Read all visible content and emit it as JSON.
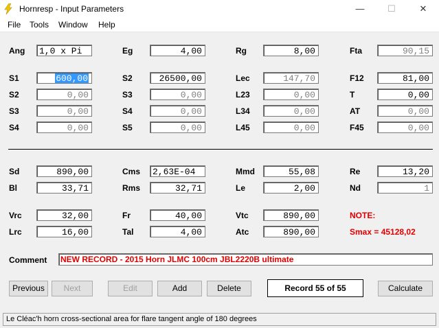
{
  "window": {
    "title": "Hornresp - Input Parameters",
    "minimize_glyph": "—",
    "maximize_glyph": "☐",
    "close_glyph": "✕"
  },
  "menu": [
    "File",
    "Tools",
    "Window",
    "Help"
  ],
  "params": {
    "Ang": {
      "label": "Ang",
      "value": "1,0 x Pi"
    },
    "Eg": {
      "label": "Eg",
      "value": "4,00"
    },
    "Rg": {
      "label": "Rg",
      "value": "8,00"
    },
    "Fta": {
      "label": "Fta",
      "value": "90,15"
    },
    "S1": {
      "label": "S1",
      "value": "600,00"
    },
    "S2a": {
      "label": "S2",
      "value": "26500,00"
    },
    "Lec": {
      "label": "Lec",
      "value": "147,70"
    },
    "F12": {
      "label": "F12",
      "value": "81,00"
    },
    "S2b": {
      "label": "S2",
      "value": "0,00"
    },
    "S3a": {
      "label": "S3",
      "value": "0,00"
    },
    "L23": {
      "label": "L23",
      "value": "0,00"
    },
    "T": {
      "label": "T",
      "value": "0,00"
    },
    "S3b": {
      "label": "S3",
      "value": "0,00"
    },
    "S4a": {
      "label": "S4",
      "value": "0,00"
    },
    "L34": {
      "label": "L34",
      "value": "0,00"
    },
    "AT": {
      "label": "AT",
      "value": "0,00"
    },
    "S4b": {
      "label": "S4",
      "value": "0,00"
    },
    "S5": {
      "label": "S5",
      "value": "0,00"
    },
    "L45": {
      "label": "L45",
      "value": "0,00"
    },
    "F45": {
      "label": "F45",
      "value": "0,00"
    },
    "Sd": {
      "label": "Sd",
      "value": "890,00"
    },
    "Cms": {
      "label": "Cms",
      "value": "2,63E-04"
    },
    "Mmd": {
      "label": "Mmd",
      "value": "55,08"
    },
    "Re": {
      "label": "Re",
      "value": "13,20"
    },
    "Bl": {
      "label": "Bl",
      "value": "33,71"
    },
    "Rms": {
      "label": "Rms",
      "value": "32,71"
    },
    "Le": {
      "label": "Le",
      "value": "2,00"
    },
    "Nd": {
      "label": "Nd",
      "value": "1"
    },
    "Vrc": {
      "label": "Vrc",
      "value": "32,00"
    },
    "Fr": {
      "label": "Fr",
      "value": "40,00"
    },
    "Vtc": {
      "label": "Vtc",
      "value": "890,00"
    },
    "Lrc": {
      "label": "Lrc",
      "value": "16,00"
    },
    "Tal": {
      "label": "Tal",
      "value": "4,00"
    },
    "Atc": {
      "label": "Atc",
      "value": "890,00"
    }
  },
  "note": {
    "title": "NOTE:",
    "text": "Smax = 45128,02"
  },
  "comment": {
    "label": "Comment",
    "value": "NEW RECORD - 2015 Horn JLMC 100cm JBL2220B ultimate"
  },
  "buttons": {
    "previous": "Previous",
    "next": "Next",
    "edit": "Edit",
    "add": "Add",
    "delete": "Delete",
    "calculate": "Calculate"
  },
  "record": "Record 55 of 55",
  "status": "Le Cléac'h horn cross-sectional area for flare tangent angle of 180 degrees",
  "colors": {
    "note_red": "#e00000",
    "selection": "#3399ff",
    "app_icon": "#f5c400"
  }
}
